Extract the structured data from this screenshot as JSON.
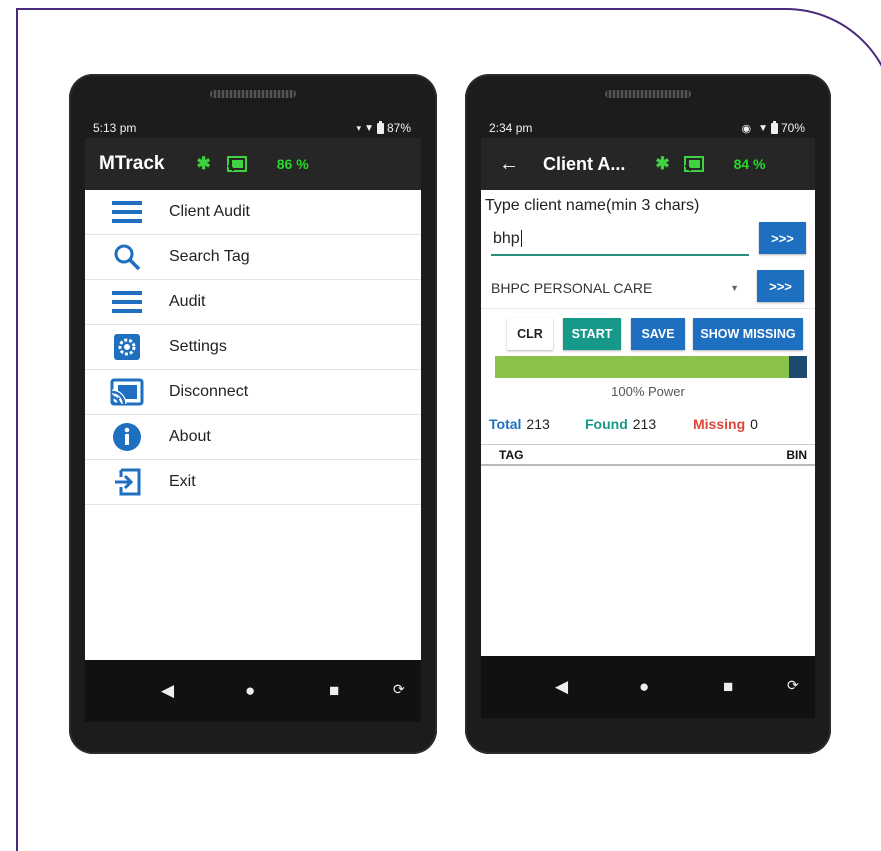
{
  "left_phone": {
    "status": {
      "time": "5:13 pm",
      "battery": "87%"
    },
    "appbar": {
      "title": "MTrack",
      "percent": "86 %"
    },
    "menu": [
      {
        "label": "Client Audit",
        "icon": "list-lines-icon"
      },
      {
        "label": "Search Tag",
        "icon": "search-icon"
      },
      {
        "label": "Audit",
        "icon": "list-lines-icon"
      },
      {
        "label": "Settings",
        "icon": "gear-icon"
      },
      {
        "label": "Disconnect",
        "icon": "cast-icon"
      },
      {
        "label": "About",
        "icon": "info-icon"
      },
      {
        "label": "Exit",
        "icon": "exit-icon"
      }
    ]
  },
  "right_phone": {
    "status": {
      "time": "2:34 pm",
      "battery": "70%"
    },
    "appbar": {
      "title": "Client A...",
      "percent": "84 %"
    },
    "prompt": "Type client name(min 3 chars)",
    "input_value": "bhp",
    "go_label": ">>>",
    "selected_client": "BHPC PERSONAL CARE",
    "buttons": {
      "clr": "CLR",
      "start": "START",
      "save": "SAVE",
      "show_missing": "SHOW MISSING"
    },
    "power": {
      "value": 1.0,
      "label": "100%  Power"
    },
    "counts": {
      "total_label": "Total",
      "total": "213",
      "found_label": "Found",
      "found": "213",
      "missing_label": "Missing",
      "missing": "0"
    },
    "table": {
      "col1": "TAG",
      "col2": "BIN"
    }
  },
  "colors": {
    "accent_blue": "#1e6fc0",
    "teal": "#17998a",
    "green_status": "#29d629",
    "missing_red": "#e0443a",
    "frame": "#4a2a7a"
  }
}
